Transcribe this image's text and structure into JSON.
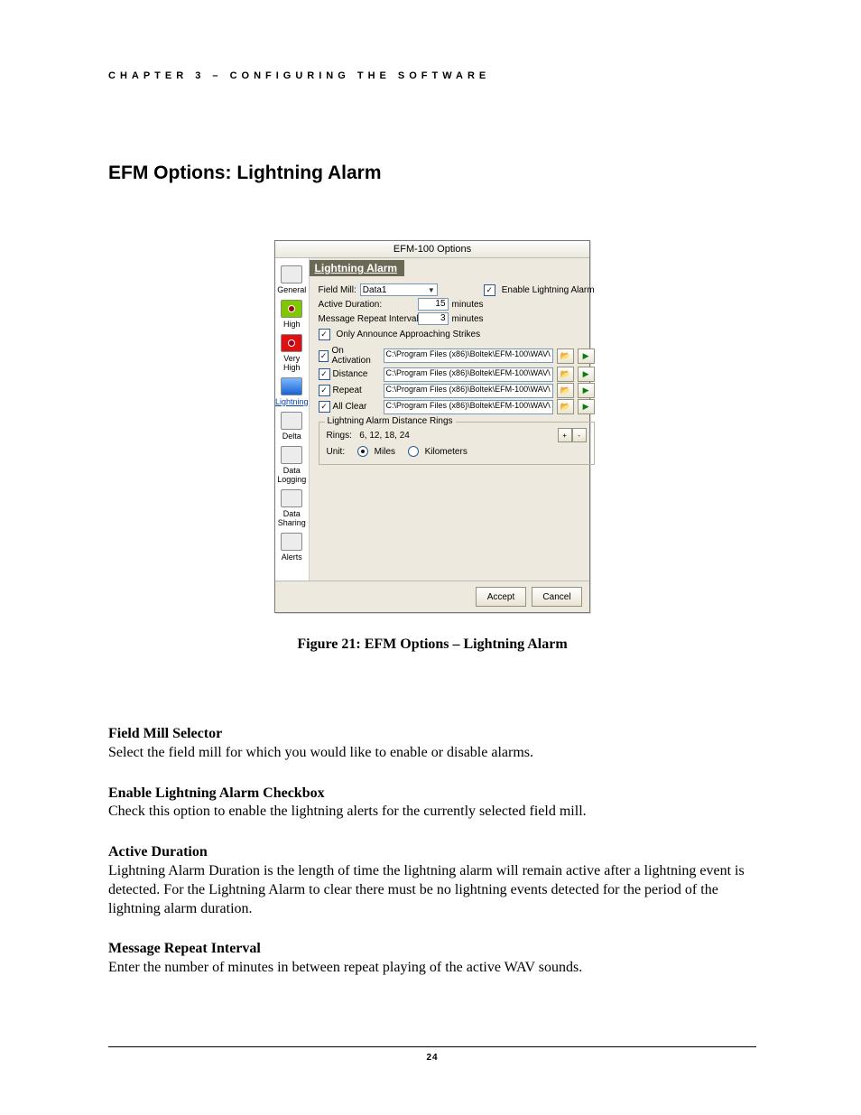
{
  "header": "CHAPTER 3 – CONFIGURING THE SOFTWARE",
  "section_title": "EFM Options: Lightning Alarm",
  "dialog": {
    "title": "EFM-100 Options",
    "sidebar": [
      {
        "label": "General",
        "icon": "plain"
      },
      {
        "label": "High",
        "icon": "green"
      },
      {
        "label": "Very High",
        "icon": "red"
      },
      {
        "label": "Lightning",
        "icon": "blue",
        "selected": true
      },
      {
        "label": "Delta",
        "icon": "plain"
      },
      {
        "label": "Data Logging",
        "icon": "plain"
      },
      {
        "label": "Data Sharing",
        "icon": "plain"
      },
      {
        "label": "Alerts",
        "icon": "plain"
      }
    ],
    "panel_title": "Lightning Alarm",
    "field_mill_label": "Field Mill:",
    "field_mill_value": "Data1",
    "enable_label": "Enable Lightning Alarm",
    "enable_checked": true,
    "active_label": "Active Duration:",
    "active_value": "15",
    "active_unit": "minutes",
    "repeat_label": "Message Repeat Interval:",
    "repeat_value": "3",
    "repeat_unit": "minutes",
    "announce_label": "Only Announce Approaching Strikes",
    "announce_checked": true,
    "sounds": [
      {
        "label": "On Activation",
        "checked": true,
        "path": "C:\\Program Files (x86)\\Boltek\\EFM-100\\WAV\\"
      },
      {
        "label": "Distance",
        "checked": true,
        "path": "C:\\Program Files (x86)\\Boltek\\EFM-100\\WAV\\"
      },
      {
        "label": "Repeat",
        "checked": true,
        "path": "C:\\Program Files (x86)\\Boltek\\EFM-100\\WAV\\"
      },
      {
        "label": "All Clear",
        "checked": true,
        "path": "C:\\Program Files (x86)\\Boltek\\EFM-100\\WAV\\"
      }
    ],
    "rings_group": "Lightning Alarm Distance Rings",
    "rings_label": "Rings:",
    "rings_value": "6, 12, 18, 24",
    "unit_label": "Unit:",
    "unit_miles": "Miles",
    "unit_km": "Kilometers",
    "accept": "Accept",
    "cancel": "Cancel"
  },
  "caption": "Figure 21:  EFM Options – Lightning Alarm",
  "body": [
    {
      "title": "Field Mill Selector",
      "text": "Select the field mill for which you would like to enable or disable alarms."
    },
    {
      "title": "Enable Lightning Alarm Checkbox",
      "text": "Check this option to enable the lightning alerts for the currently selected field mill."
    },
    {
      "title": "Active Duration",
      "text": "Lightning Alarm Duration is the length of time the lightning alarm will remain active after a lightning event is detected.  For the Lightning Alarm to clear there must be no lightning events detected for the period of the lightning alarm duration."
    },
    {
      "title": "Message Repeat Interval",
      "text": "Enter the number of minutes in between repeat playing of the active WAV sounds."
    }
  ],
  "page_number": "24"
}
